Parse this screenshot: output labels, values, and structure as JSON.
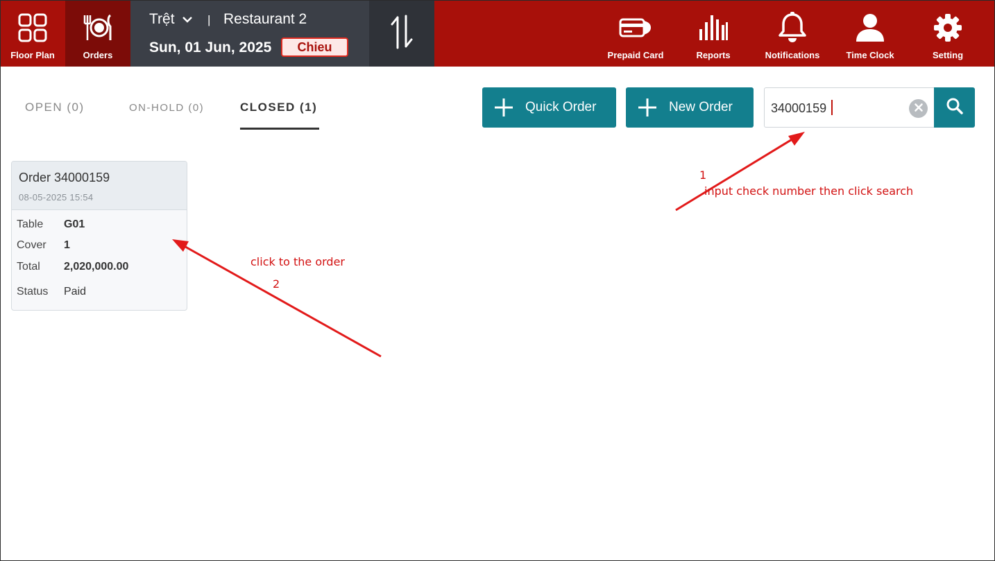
{
  "nav": {
    "floor_plan": "Floor Plan",
    "orders": "Orders",
    "prepaid_card": "Prepaid Card",
    "reports": "Reports",
    "notifications": "Notifications",
    "time_clock": "Time Clock",
    "setting": "Setting"
  },
  "context": {
    "floor": "Trệt",
    "separator": "|",
    "restaurant": "Restaurant 2",
    "date": "Sun, 01 Jun, 2025",
    "shift": "Chieu"
  },
  "tabs": {
    "open": "OPEN (0)",
    "on_hold": "ON-HOLD (0)",
    "closed": "CLOSED (1)"
  },
  "actions": {
    "quick_order": "Quick Order",
    "new_order": "New Order"
  },
  "search": {
    "value": "34000159"
  },
  "order_card": {
    "title": "Order 34000159",
    "datetime": "08-05-2025 15:54",
    "rows": [
      {
        "label": "Table",
        "value": "G01"
      },
      {
        "label": "Cover",
        "value": "1"
      },
      {
        "label": "Total",
        "value": "2,020,000.00"
      },
      {
        "label": "Status",
        "value": "Paid"
      }
    ]
  },
  "annotations": {
    "step1_number": "1",
    "step1_text": "input check number then click search",
    "step2_text": "click to the order",
    "step2_number": "2"
  },
  "colors": {
    "topbar": "#a8100a",
    "topbar_active": "#7c0c08",
    "context_bg": "#3b3f47",
    "accent_teal": "#137f8e",
    "annotation_red": "#d21111"
  }
}
